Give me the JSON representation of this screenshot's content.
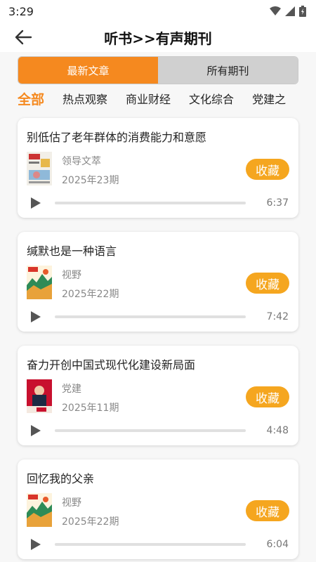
{
  "status": {
    "time": "3:29"
  },
  "header": {
    "title": "听书>>有声期刊"
  },
  "tabs": {
    "latest": "最新文章",
    "all": "所有期刊"
  },
  "categories": [
    "全部",
    "热点观察",
    "商业财经",
    "文化综合",
    "党建之"
  ],
  "items": [
    {
      "title": "别低估了老年群体的消费能力和意愿",
      "magazine": "领导文萃",
      "issue": "2025年23期",
      "fav": "收藏",
      "duration": "6:37",
      "cover": "lingdao"
    },
    {
      "title": "缄默也是一种语言",
      "magazine": "视野",
      "issue": "2025年22期",
      "fav": "收藏",
      "duration": "7:42",
      "cover": "shiye"
    },
    {
      "title": "奋力开创中国式现代化建设新局面",
      "magazine": "党建",
      "issue": "2025年11期",
      "fav": "收藏",
      "duration": "4:48",
      "cover": "dangjian"
    },
    {
      "title": "回忆我的父亲",
      "magazine": "视野",
      "issue": "2025年22期",
      "fav": "收藏",
      "duration": "6:04",
      "cover": "shiye"
    }
  ],
  "colors": {
    "accent": "#f5891f",
    "favorite": "#f5a61f"
  }
}
